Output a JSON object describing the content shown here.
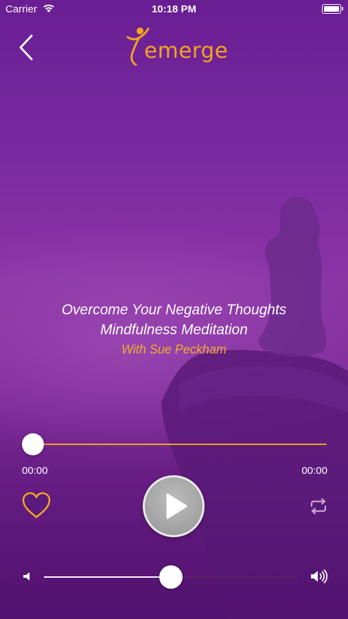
{
  "status_bar": {
    "carrier": "Carrier",
    "time": "10:18 PM",
    "wifi_icon": "wifi-icon",
    "battery_icon": "battery-icon"
  },
  "header": {
    "back_icon": "chevron-left-icon",
    "logo_text": "emerge"
  },
  "track": {
    "title": "Overcome Your Negative Thoughts",
    "subtitle": "Mindfulness Meditation",
    "author": "With Sue Peckham"
  },
  "player": {
    "elapsed": "00:00",
    "duration": "00:00",
    "progress": 0,
    "favorite_icon": "heart-icon",
    "play_icon": "play-icon",
    "repeat_icon": "repeat-icon",
    "volume_level": 0.5,
    "volume_low_icon": "volume-low-icon",
    "volume_high_icon": "volume-high-icon"
  },
  "colors": {
    "accent": "#f2a91f",
    "background": "#7a2aa0",
    "heart_fill": "#5b1a7d"
  }
}
